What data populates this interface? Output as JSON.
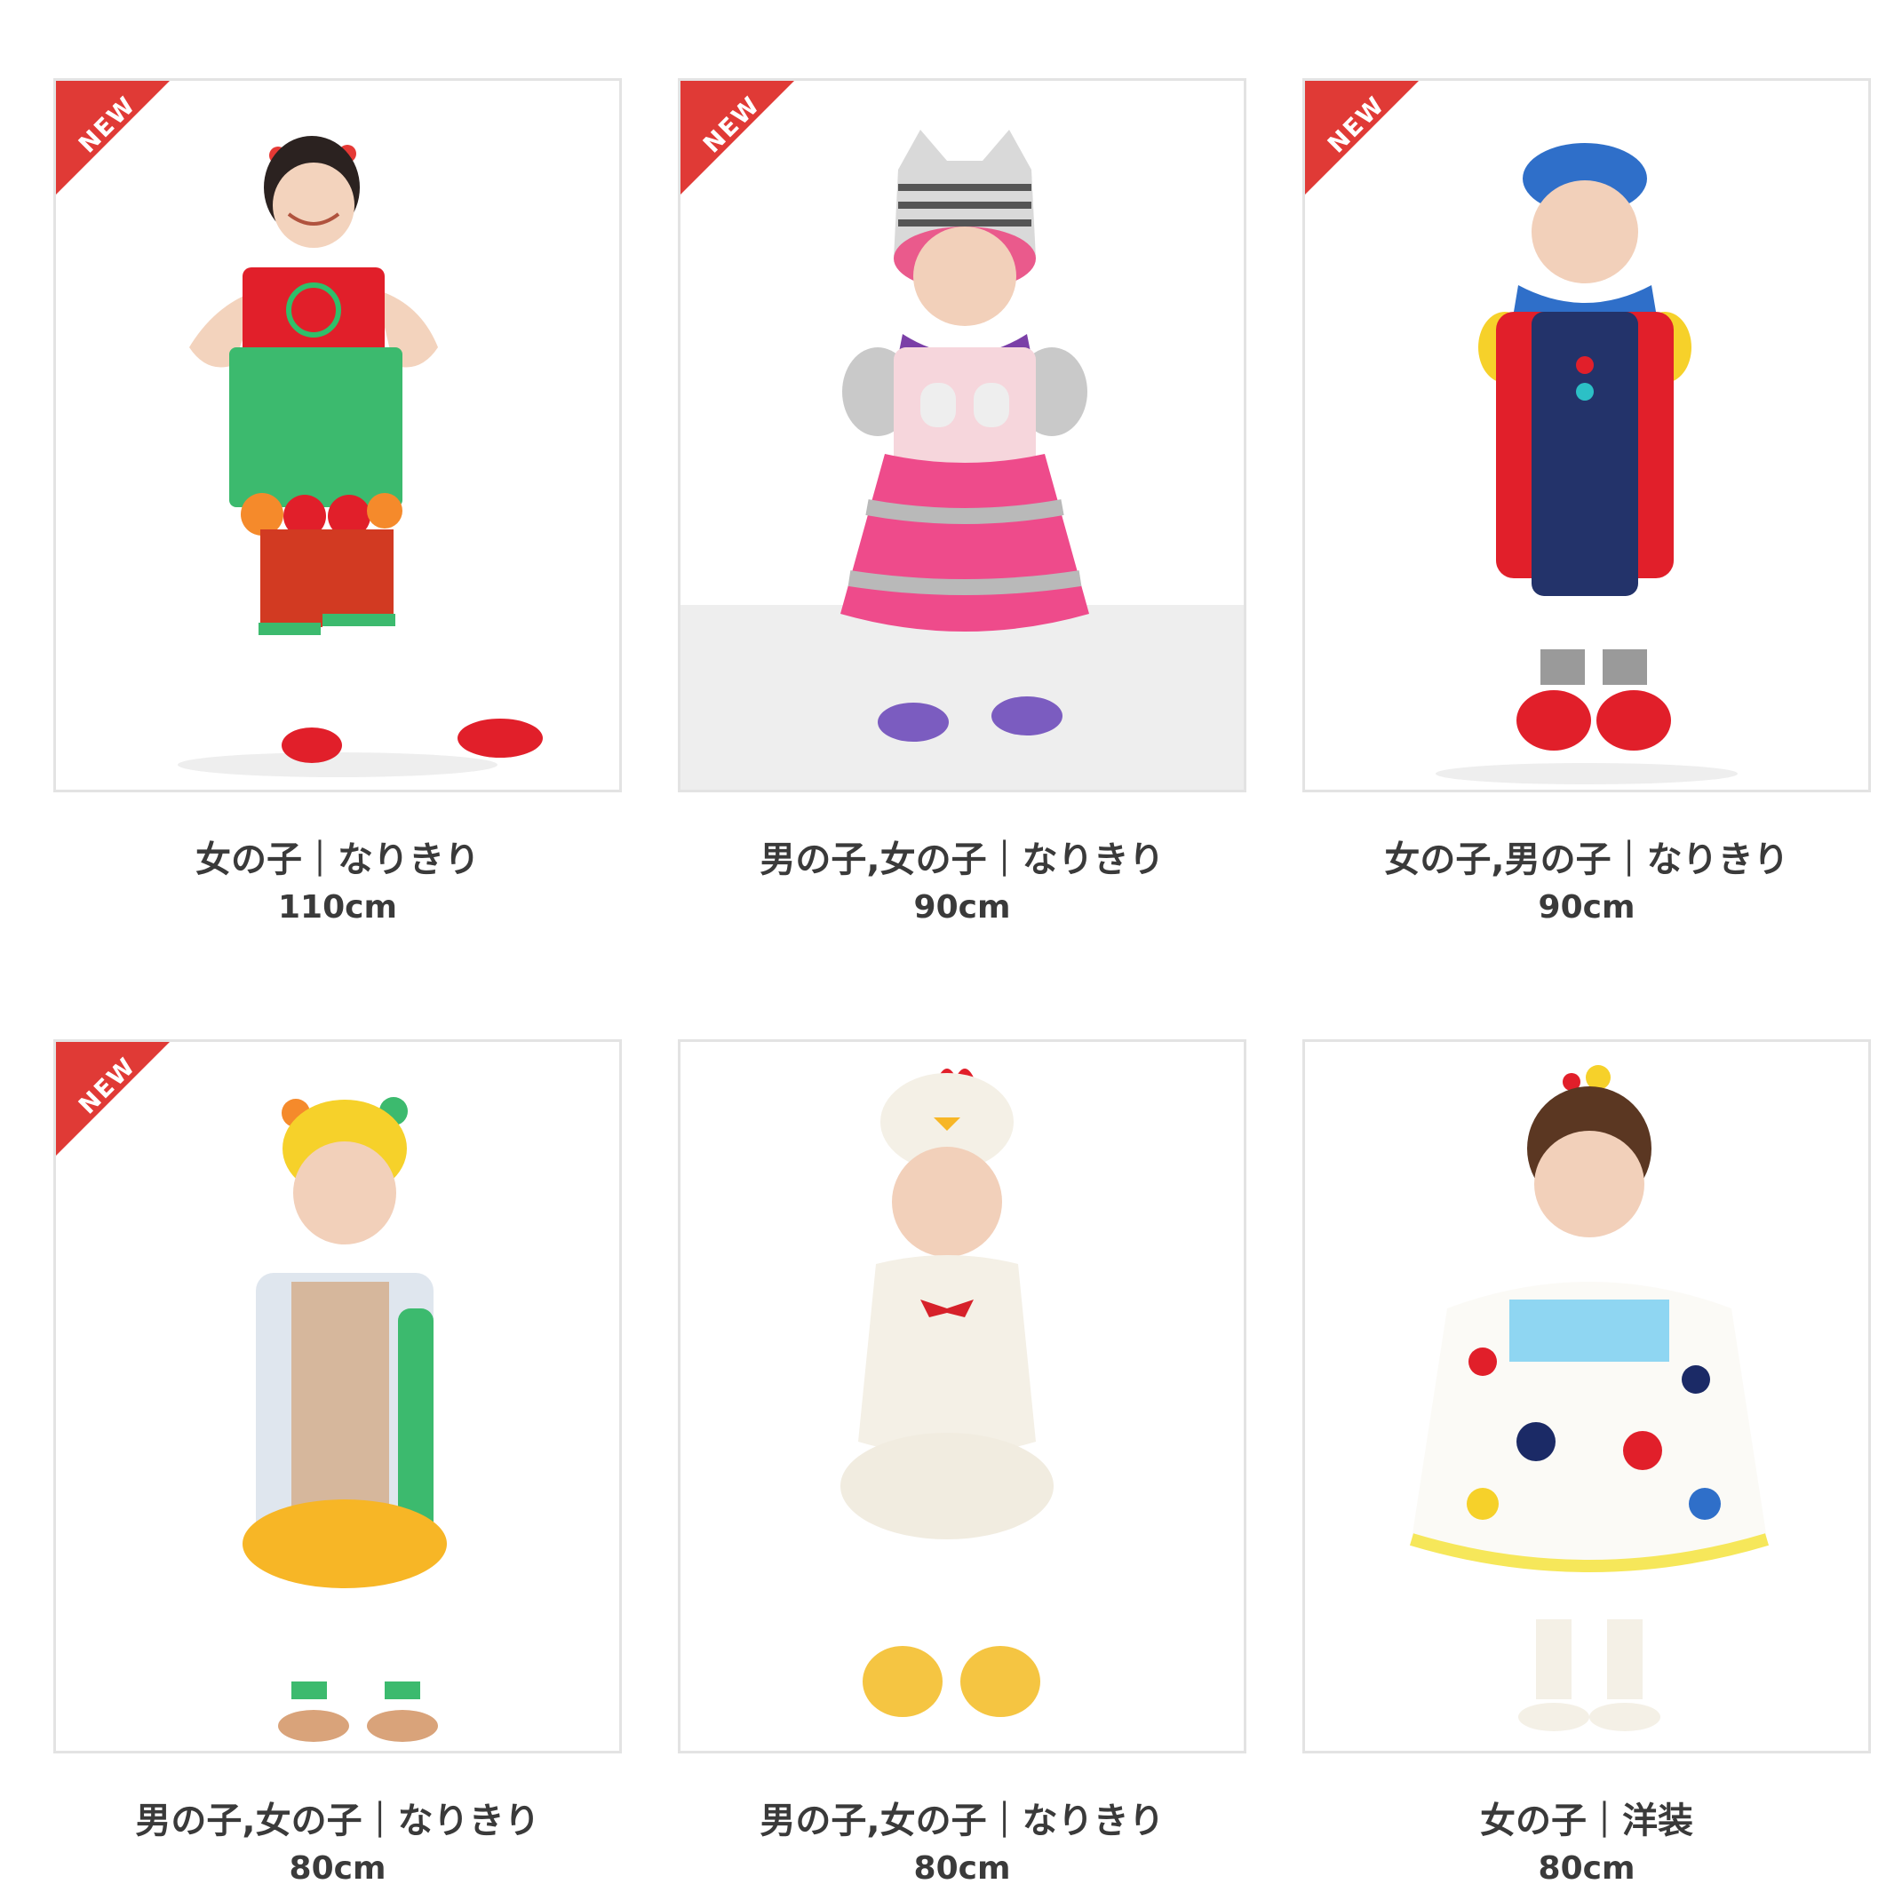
{
  "badge": "NEW",
  "products": [
    {
      "category": "女の子｜なりきり",
      "size": "110cm",
      "is_new": true
    },
    {
      "category": "男の子,女の子｜なりきり",
      "size": "90cm",
      "is_new": true
    },
    {
      "category": "女の子,男の子｜なりきり",
      "size": "90cm",
      "is_new": true
    },
    {
      "category": "男の子,女の子｜なりきり",
      "size": "80cm",
      "is_new": true
    },
    {
      "category": "男の子,女の子｜なりきり",
      "size": "80cm",
      "is_new": false
    },
    {
      "category": "女の子｜洋装",
      "size": "80cm",
      "is_new": false
    }
  ],
  "colors": {
    "badge": "#e03a36",
    "border": "#e3e3e3",
    "text": "#3a3a3a"
  }
}
